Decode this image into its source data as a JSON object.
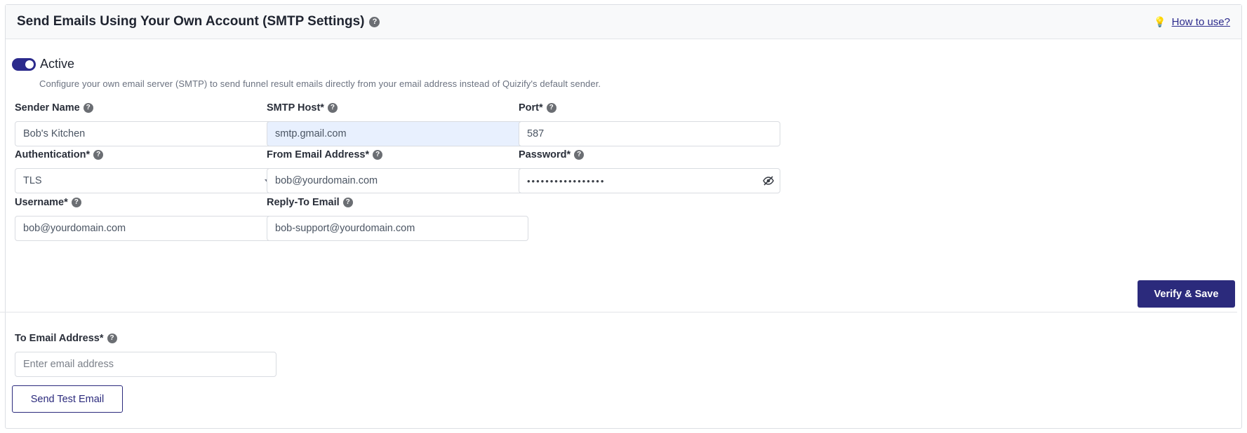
{
  "header": {
    "title": "Send Emails Using Your Own Account (SMTP Settings)",
    "help_link": "How to use?"
  },
  "status": {
    "toggle_on": true,
    "label": "Active",
    "description": "Configure your own email server (SMTP) to send funnel result emails directly from your email address instead of Quizify's default sender."
  },
  "fields": {
    "sender_name": {
      "label": "Sender Name",
      "value": "Bob's Kitchen"
    },
    "smtp_host": {
      "label": "SMTP Host*",
      "value": "smtp.gmail.com"
    },
    "port": {
      "label": "Port*",
      "value": "587"
    },
    "authentication": {
      "label": "Authentication*",
      "value": "TLS"
    },
    "from_email": {
      "label": "From Email Address*",
      "value": "bob@yourdomain.com"
    },
    "password": {
      "label": "Password*",
      "value": "•••••••••••••••••"
    },
    "username": {
      "label": "Username*",
      "value": "bob@yourdomain.com"
    },
    "reply_to": {
      "label": "Reply-To Email",
      "value": "bob-support@yourdomain.com"
    },
    "to_email": {
      "label": "To Email Address*",
      "placeholder": "Enter email address"
    }
  },
  "actions": {
    "verify_save": "Verify & Save",
    "send_test": "Send Test Email"
  },
  "icons": {
    "help": "question-circle-icon",
    "bulb": "lightbulb-icon",
    "eye": "eye-slash-icon",
    "caret": "chevron-down-icon"
  },
  "colors": {
    "accent": "#2b2a7c",
    "toggle": "#2b2a8c",
    "autofill": "#e8f0fe"
  }
}
